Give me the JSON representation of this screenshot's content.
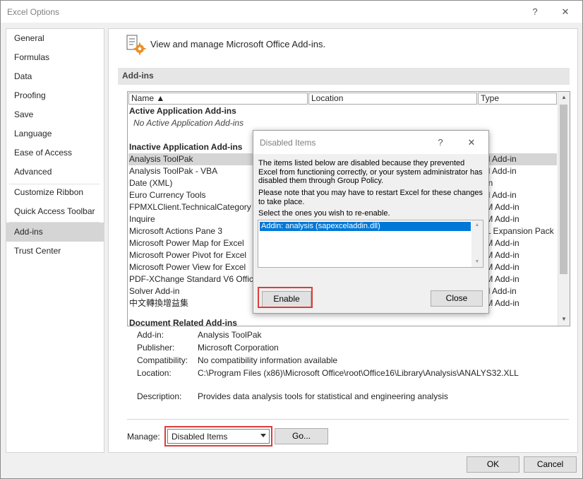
{
  "window": {
    "title": "Excel Options",
    "help": "?",
    "close": "✕"
  },
  "nav": {
    "items": [
      {
        "label": "General"
      },
      {
        "label": "Formulas"
      },
      {
        "label": "Data"
      },
      {
        "label": "Proofing"
      },
      {
        "label": "Save"
      },
      {
        "label": "Language"
      },
      {
        "label": "Ease of Access"
      },
      {
        "label": "Advanced"
      },
      {
        "label": "Customize Ribbon"
      },
      {
        "label": "Quick Access Toolbar"
      },
      {
        "label": "Add-ins",
        "selected": true
      },
      {
        "label": "Trust Center"
      }
    ]
  },
  "main": {
    "header": "View and manage Microsoft Office Add-ins.",
    "section_title": "Add-ins",
    "columns": {
      "name": "Name ▲",
      "location": "Location",
      "type": "Type"
    },
    "groups": {
      "active_title": "Active Application Add-ins",
      "active_empty": "No Active Application Add-ins",
      "inactive_title": "Inactive Application Add-ins",
      "document_title": "Document Related Add-ins"
    },
    "rows": [
      {
        "name": "Analysis ToolPak",
        "type": "cel Add-in"
      },
      {
        "name": "Analysis ToolPak - VBA",
        "type": "cel Add-in"
      },
      {
        "name": "Date (XML)",
        "type": "tion"
      },
      {
        "name": "Euro Currency Tools",
        "type": "cel Add-in"
      },
      {
        "name": "FPMXLClient.TechnicalCategory",
        "type": "OM Add-in"
      },
      {
        "name": "Inquire",
        "type": "OM Add-in"
      },
      {
        "name": "Microsoft Actions Pane 3",
        "type": "ML Expansion Pack"
      },
      {
        "name": "Microsoft Power Map for Excel",
        "type": "OM Add-in"
      },
      {
        "name": "Microsoft Power Pivot for Excel",
        "type": "OM Add-in"
      },
      {
        "name": "Microsoft Power View for Excel",
        "type": "OM Add-in"
      },
      {
        "name": "PDF-XChange Standard V6 Office",
        "type": "OM Add-in"
      },
      {
        "name": "Solver Add-in",
        "type": "cel Add-in"
      },
      {
        "name": "中文轉換增益集",
        "type": "OM Add-in"
      }
    ],
    "details": {
      "addin_label": "Add-in:",
      "addin_value": "Analysis ToolPak",
      "publisher_label": "Publisher:",
      "publisher_value": "Microsoft Corporation",
      "compat_label": "Compatibility:",
      "compat_value": "No compatibility information available",
      "location_label": "Location:",
      "location_value": "C:\\Program Files (x86)\\Microsoft Office\\root\\Office16\\Library\\Analysis\\ANALYS32.XLL",
      "desc_label": "Description:",
      "desc_value": "Provides data analysis tools for statistical and engineering analysis"
    },
    "manage_label": "Manage:",
    "manage_value": "Disabled Items",
    "go_label": "Go..."
  },
  "footer": {
    "ok": "OK",
    "cancel": "Cancel"
  },
  "dialog": {
    "title": "Disabled Items",
    "help": "?",
    "close": "✕",
    "text1": "The items listed below are disabled because they prevented Excel from functioning correctly, or your system administrator has disabled them through Group Policy.",
    "text2": "Please note that you may have to restart Excel for these changes to take place.",
    "text3": "Select the ones you wish to re-enable.",
    "list_items": [
      "Addin: analysis (sapexceladdin.dll)"
    ],
    "enable_label": "Enable",
    "close_label": "Close"
  },
  "colors": {
    "highlight": "#e03c3c",
    "selection": "#0078d7",
    "nav_selected": "#d5d5d5"
  }
}
